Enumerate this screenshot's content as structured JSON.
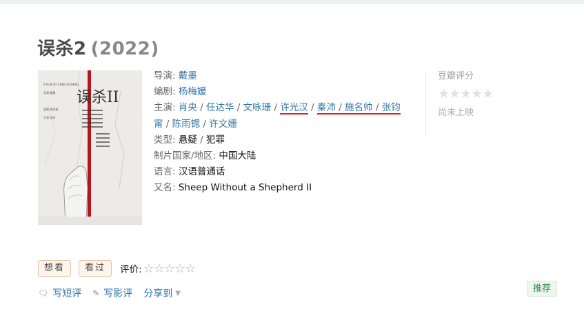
{
  "title": {
    "name": "误杀2",
    "year": "(2022)"
  },
  "poster": {
    "alt": "误杀2 poster",
    "title_glyph": "误杀II",
    "credits": [
      "A FILM BY CHEN SICHENG",
      "导演 戴墨",
      "监制 陈思诚",
      "主演 肖央"
    ]
  },
  "info": {
    "director": {
      "label": "导演",
      "values": [
        "戴墨"
      ]
    },
    "writer": {
      "label": "编剧",
      "values": [
        "杨梅媛"
      ]
    },
    "cast": {
      "label": "主演",
      "values": [
        "肖央",
        "任达华",
        "文咏珊",
        "许光汉",
        "秦沛",
        "施名帅",
        "张钧甯",
        "陈雨锶",
        "许文姗"
      ],
      "line1_last_partial": "张钧",
      "line2_first_partial": "甯"
    },
    "genre": {
      "label": "类型",
      "values": [
        "悬疑",
        "犯罪"
      ]
    },
    "region": {
      "label": "制片国家/地区",
      "value": "中国大陆"
    },
    "language": {
      "label": "语言",
      "value": "汉语普通话"
    },
    "aka": {
      "label": "又名",
      "value": "Sheep Without a Shepherd II"
    },
    "separator": " / ",
    "colon": ": "
  },
  "rating": {
    "label": "豆瓣评分",
    "stars": "★★★★★",
    "status": "尚未上映"
  },
  "actions": {
    "want": "想看",
    "seen": "看过",
    "rate_label": "评价:",
    "rate_stars": "☆☆☆☆☆"
  },
  "links": {
    "short_review": "写短评",
    "review": "写影评",
    "share": "分享到"
  },
  "recommend": "推荐",
  "colors": {
    "link": "#3377aa",
    "title": "#494949",
    "underline": "#e0211d",
    "button_bg": "#fff5ed",
    "recommend": "#2d8a4d"
  }
}
